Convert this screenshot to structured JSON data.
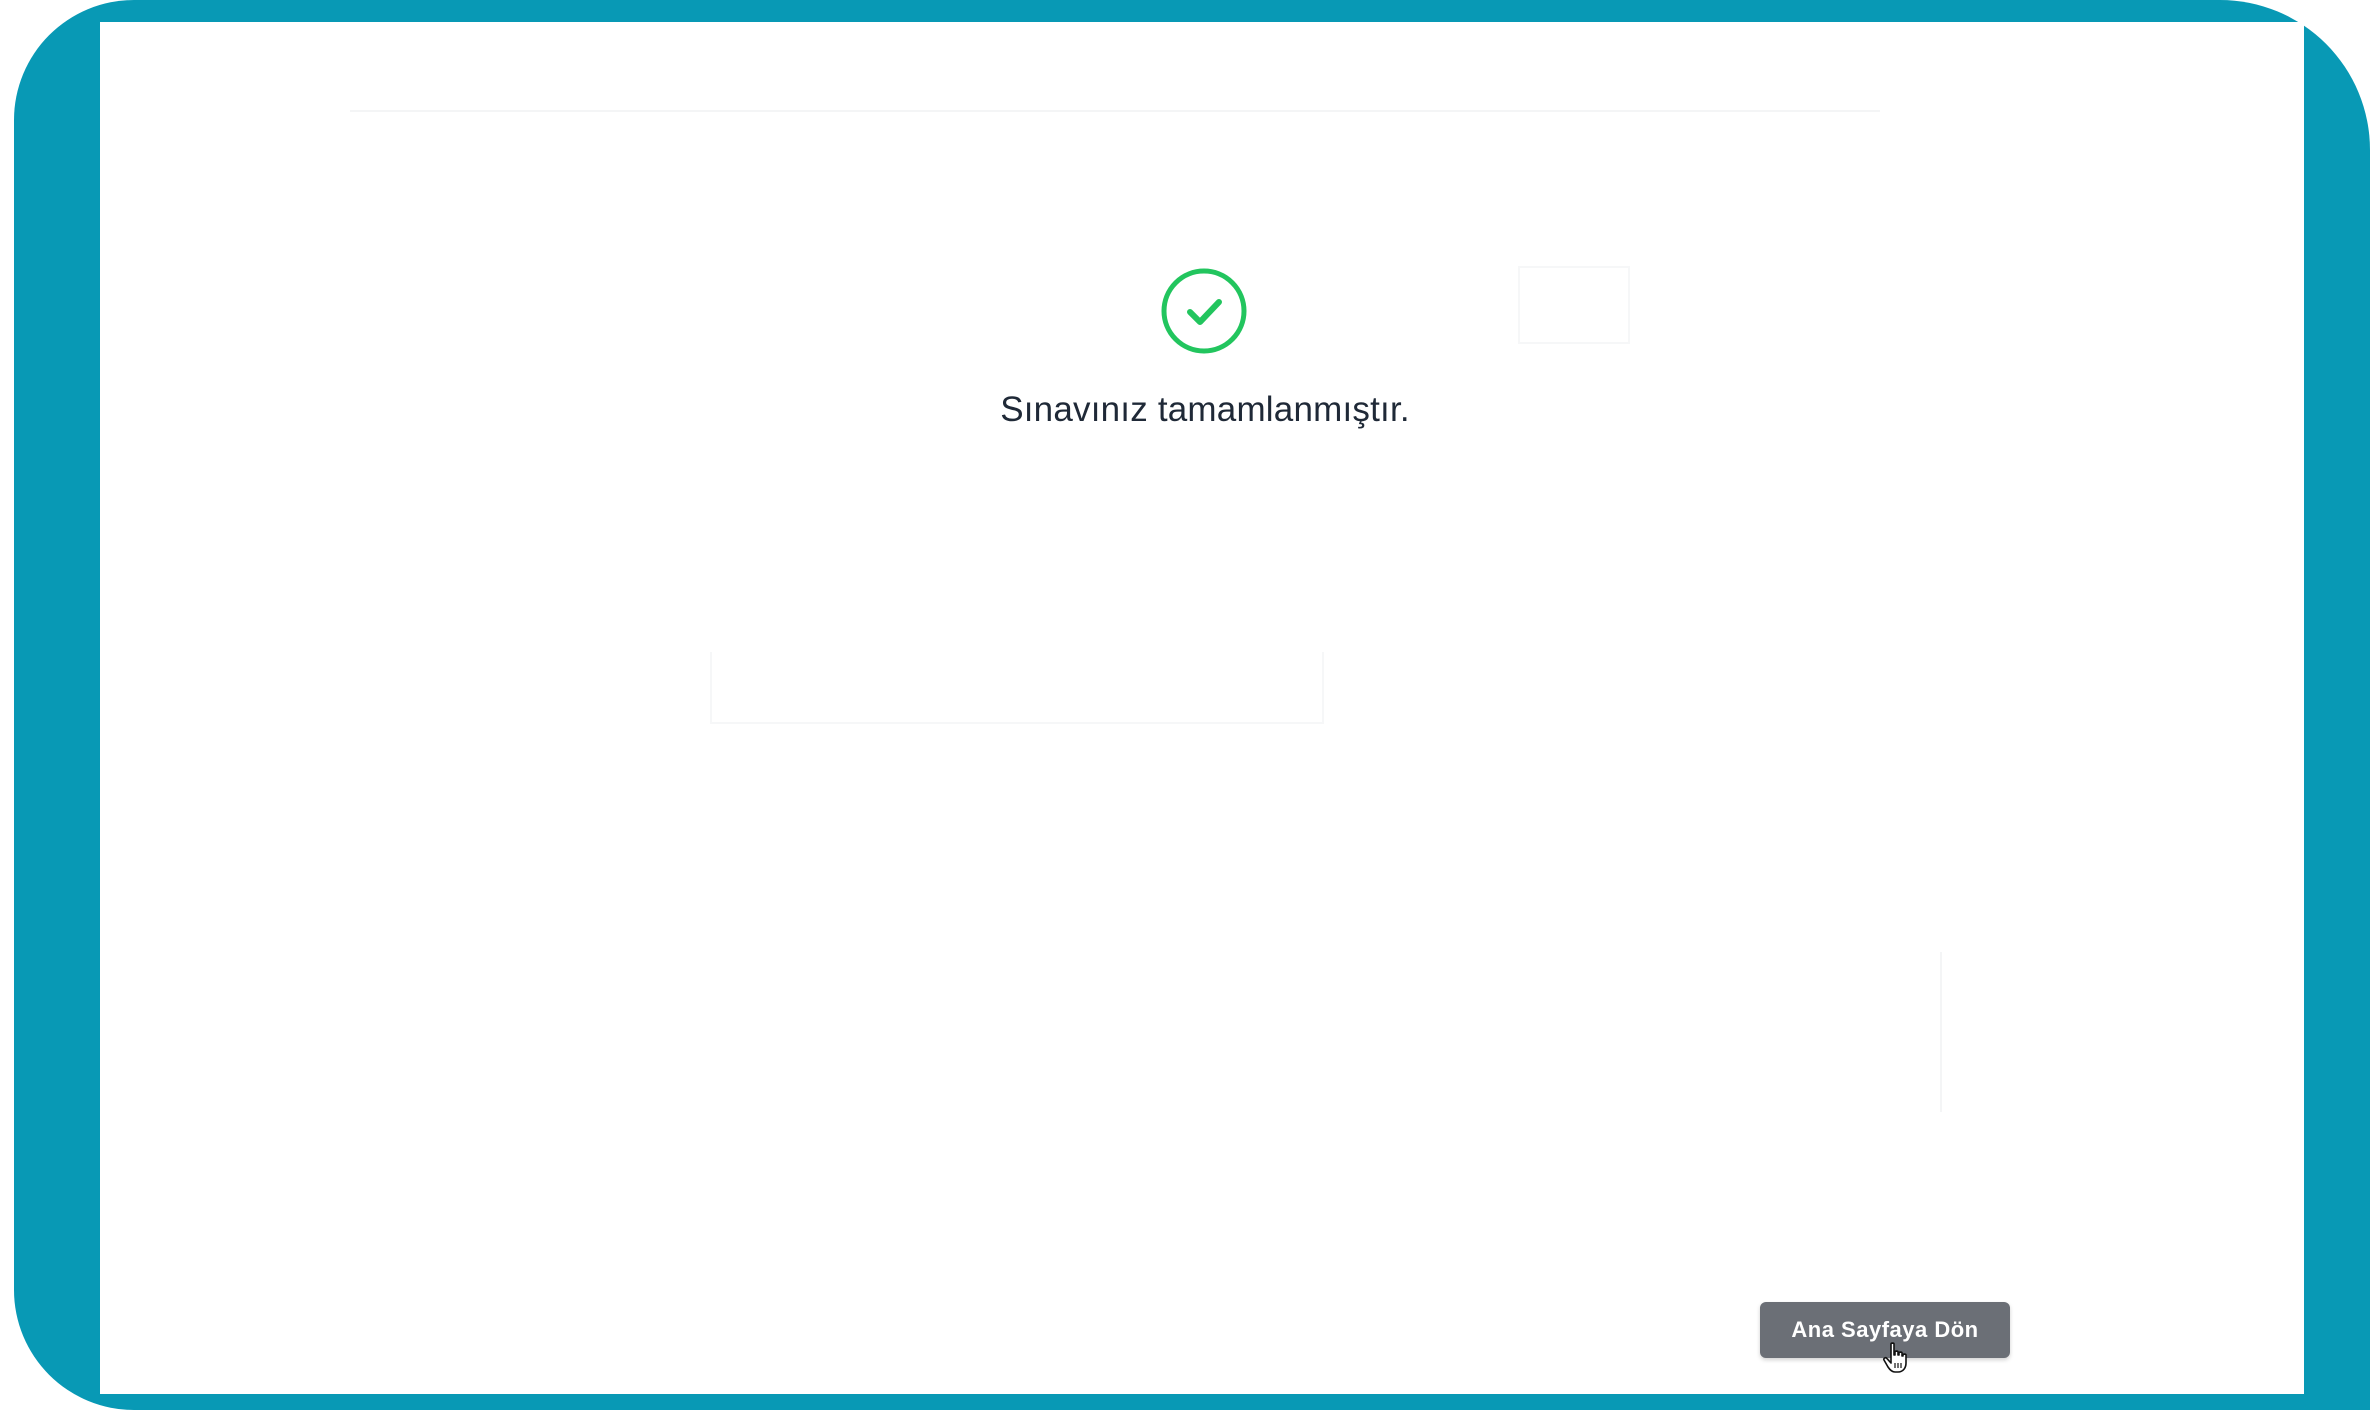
{
  "result": {
    "message": "Sınavınız tamamlanmıştır.",
    "icon": "check-circle-icon",
    "icon_color": "#22c55e"
  },
  "actions": {
    "home_label": "Ana Sayfaya Dön",
    "button_color": "#6b6f76"
  },
  "frame": {
    "border_color": "#0899b5"
  },
  "cursor": {
    "icon": "hand-pointer-icon"
  }
}
